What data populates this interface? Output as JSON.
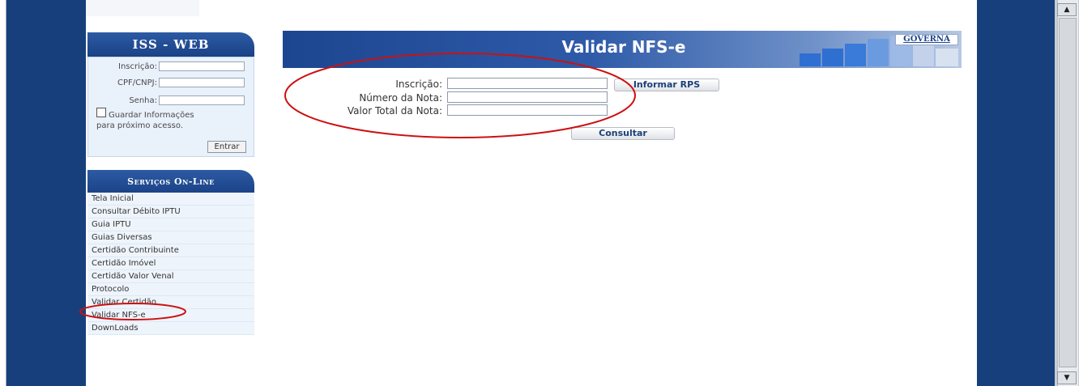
{
  "login": {
    "title": "ISS - WEB",
    "inscricao_label": "Inscrição:",
    "cpf_label": "CPF/CNPJ:",
    "senha_label": "Senha:",
    "remember_line1": "Guardar Informações",
    "remember_line2": "para próximo acesso.",
    "remember_checked": false,
    "enter_label": "Entrar"
  },
  "services": {
    "title": "Serviços On-Line",
    "items": [
      "Tela Inicial",
      "Consultar Débito IPTU",
      "Guia IPTU",
      "Guias Diversas",
      "Certidão Contribuinte",
      "Certidão Imóvel",
      "Certidão Valor Venal",
      "Protocolo",
      "Validar Certidão",
      "Validar NFS-e",
      "DownLoads"
    ]
  },
  "banner": {
    "title": "Validar NFS-e",
    "logo_text": "GOVERNA"
  },
  "form": {
    "inscricao_label": "Inscrição:",
    "numero_label": "Número da Nota:",
    "valor_label": "Valor Total da Nota:",
    "inscricao_value": "",
    "numero_value": "",
    "valor_value": "",
    "informar_rps_label": "Informar RPS",
    "consultar_label": "Consultar"
  },
  "colors": {
    "frame_blue": "#173f7c",
    "panel_blue": "#1a4186",
    "annotation_red": "#cc1111"
  },
  "scrollbar": {
    "up_icon": "▲",
    "down_icon": "▼"
  }
}
